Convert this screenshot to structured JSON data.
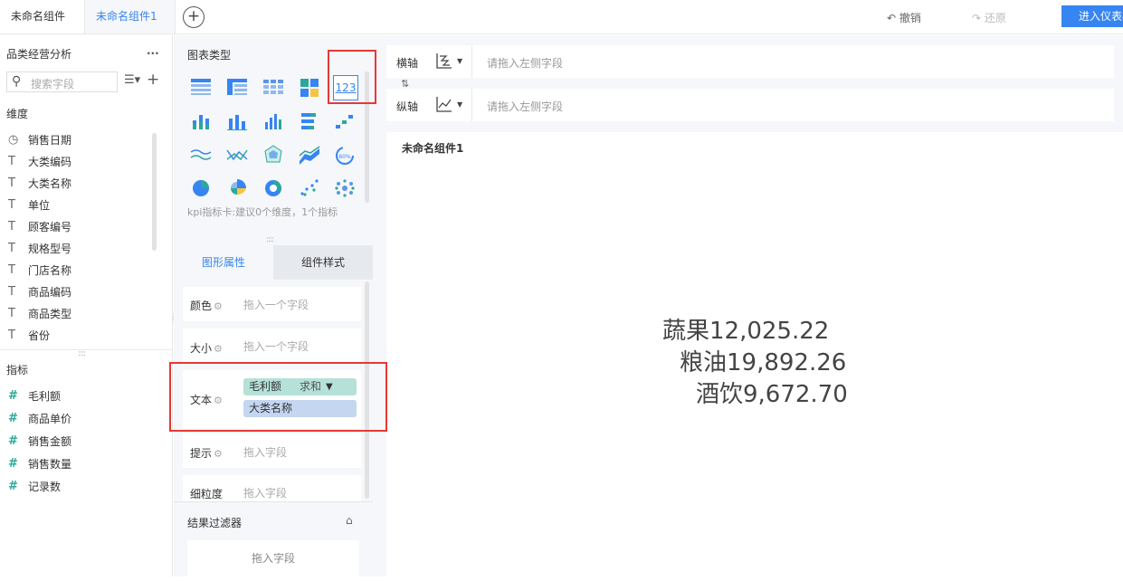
{
  "tabs": [
    {
      "label": "未命名组件"
    },
    {
      "label": "未命名组件1"
    }
  ],
  "toolbar": {
    "undo_label": "撤销",
    "redo_label": "还原",
    "enter_label": "进入仪表板"
  },
  "datasource": {
    "title": "品类经营分析",
    "more": "...",
    "search_placeholder": "搜索字段",
    "dimensions_label": "维度",
    "dimensions": [
      {
        "icon": "clock-icon",
        "label": "销售日期"
      },
      {
        "icon": "text-type-icon",
        "label": "大类编码"
      },
      {
        "icon": "text-type-icon",
        "label": "大类名称"
      },
      {
        "icon": "text-type-icon",
        "label": "单位"
      },
      {
        "icon": "text-type-icon",
        "label": "顾客编号"
      },
      {
        "icon": "text-type-icon",
        "label": "规格型号"
      },
      {
        "icon": "text-type-icon",
        "label": "门店名称"
      },
      {
        "icon": "text-type-icon",
        "label": "商品编码"
      },
      {
        "icon": "text-type-icon",
        "label": "商品类型"
      },
      {
        "icon": "text-type-icon",
        "label": "省份"
      }
    ],
    "measures_label": "指标",
    "measures": [
      {
        "icon": "hash-icon",
        "label": "毛利额"
      },
      {
        "icon": "hash-icon",
        "label": "商品单价"
      },
      {
        "icon": "hash-icon",
        "label": "销售金额"
      },
      {
        "icon": "hash-icon",
        "label": "销售数量"
      },
      {
        "icon": "hash-icon",
        "label": "记录数"
      }
    ]
  },
  "chart_types": {
    "title": "图表类型",
    "hint": "kpi指标卡:建议0个维度，1个指标",
    "selected_label": "123"
  },
  "props": {
    "tab_shape": "图形属性",
    "tab_style": "组件样式",
    "color_label": "颜色",
    "color_placeholder": "拖入一个字段",
    "size_label": "大小",
    "size_placeholder": "拖入一个字段",
    "text_label": "文本",
    "text_pills": [
      {
        "label": "毛利额",
        "agg": "求和"
      },
      {
        "label": "大类名称"
      }
    ],
    "tip_label": "提示",
    "tip_placeholder": "拖入字段",
    "granularity_label": "细粒度",
    "granularity_placeholder": "拖入字段",
    "filter_title": "结果过滤器",
    "filter_placeholder": "拖入字段"
  },
  "axes": {
    "x_label": "横轴",
    "y_label": "纵轴",
    "placeholder": "请拖入左侧字段"
  },
  "component": {
    "title": "未命名组件1",
    "kpi_lines": [
      "蔬果12,025.22",
      "粮油19,892.26",
      "酒饮9,672.70"
    ]
  },
  "colors": {
    "accent": "#3685f2",
    "measure": "#2ba89b",
    "highlight": "#e53935"
  }
}
